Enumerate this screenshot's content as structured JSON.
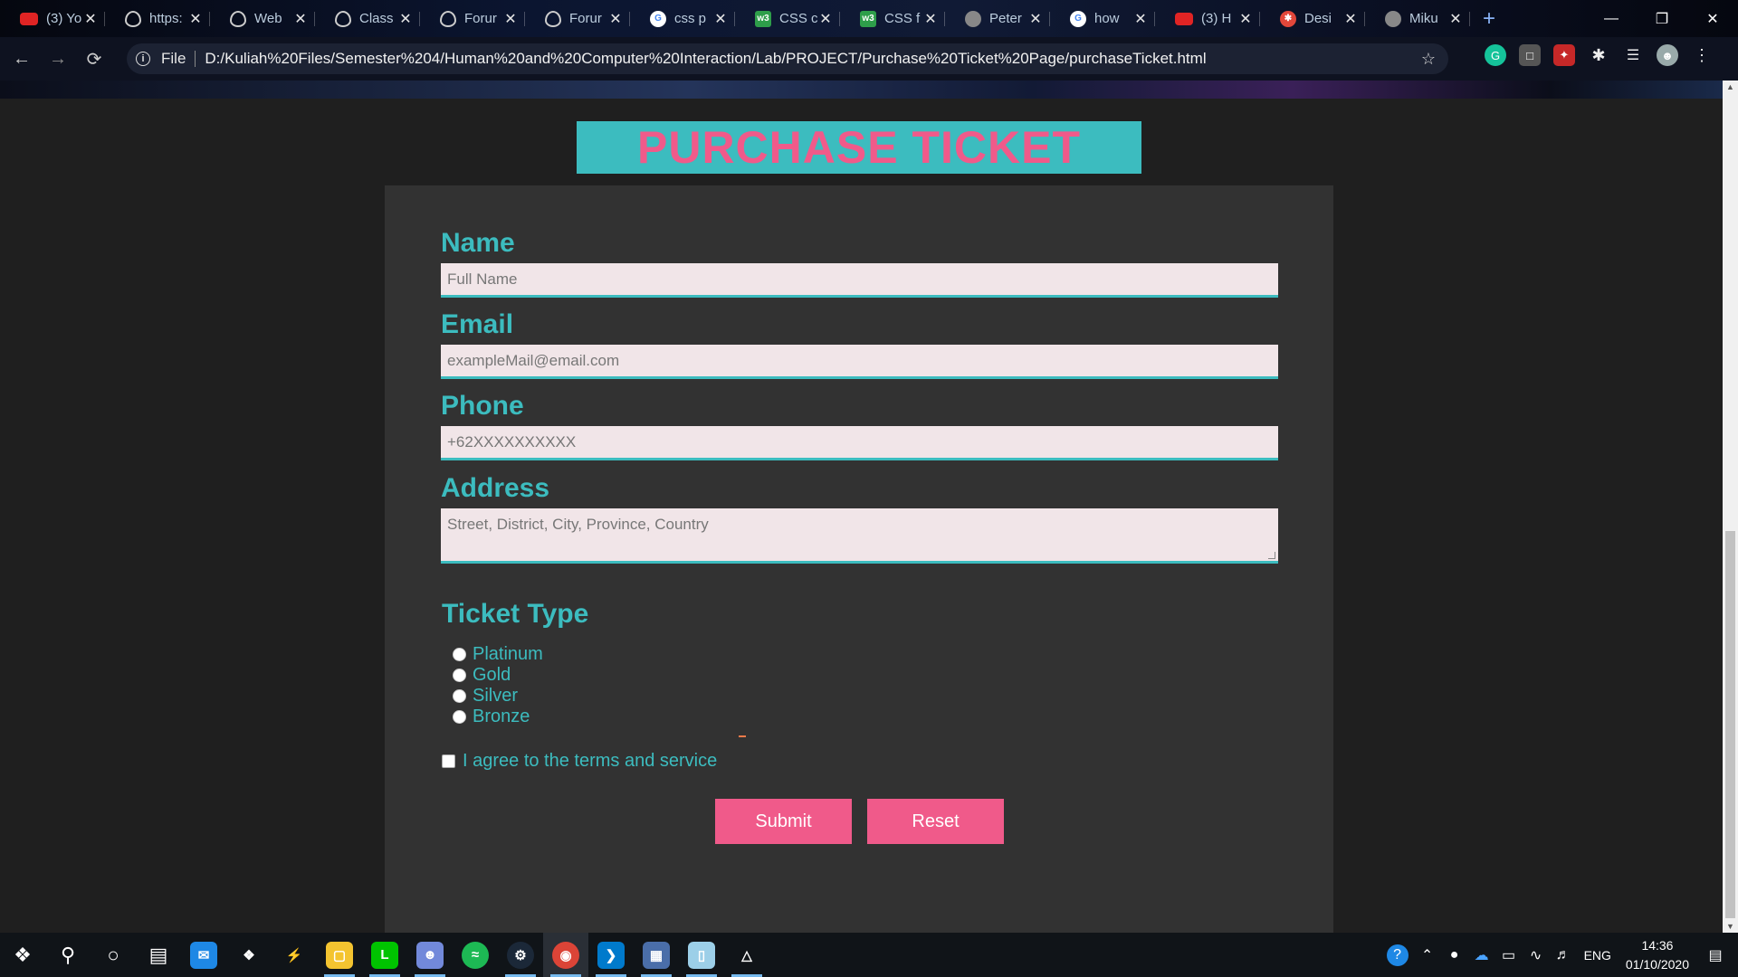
{
  "browser": {
    "tabs": [
      {
        "title": "(3) Yo",
        "icon": "youtube-icon"
      },
      {
        "title": "https:",
        "icon": "eye-icon"
      },
      {
        "title": "Web",
        "icon": "eye-icon"
      },
      {
        "title": "Class",
        "icon": "eye-icon"
      },
      {
        "title": "Forur",
        "icon": "eye-icon"
      },
      {
        "title": "Forur",
        "icon": "eye-icon"
      },
      {
        "title": "css p",
        "icon": "google-icon"
      },
      {
        "title": "CSS c",
        "icon": "w3schools-icon"
      },
      {
        "title": "CSS f",
        "icon": "w3schools-icon"
      },
      {
        "title": "Peter",
        "icon": "globe-icon"
      },
      {
        "title": "how",
        "icon": "google-icon"
      },
      {
        "title": "(3) H",
        "icon": "youtube-icon"
      },
      {
        "title": "Desi",
        "icon": "design-icon"
      },
      {
        "title": "Miku",
        "icon": "globe-icon"
      }
    ],
    "new_tab": "+",
    "tab_close": "✕",
    "address_prefix": "File",
    "url": "D:/Kuliah%20Files/Semester%204/Human%20and%20Computer%20Interaction/Lab/PROJECT/Purchase%20Ticket%20Page/purchaseTicket.html"
  },
  "page": {
    "title": "PURCHASE TICKET",
    "form": {
      "name_label": "Name",
      "name_placeholder": "Full Name",
      "email_label": "Email",
      "email_placeholder": "exampleMail@email.com",
      "phone_label": "Phone",
      "phone_placeholder": "+62XXXXXXXXXX",
      "address_label": "Address",
      "address_placeholder": "Street, District, City, Province, Country",
      "ticket_type_label": "Ticket Type",
      "ticket_options": [
        "Platinum",
        "Gold",
        "Silver",
        "Bronze"
      ],
      "agree_label": "I agree to the terms and service",
      "submit_label": "Submit",
      "reset_label": "Reset"
    },
    "colors": {
      "accent": "#3cbcbf",
      "pink": "#f05a8a",
      "card": "#323232",
      "input_bg": "#f1e5e8"
    }
  },
  "taskbar": {
    "language": "ENG",
    "time": "14:36",
    "date": "01/10/2020"
  }
}
